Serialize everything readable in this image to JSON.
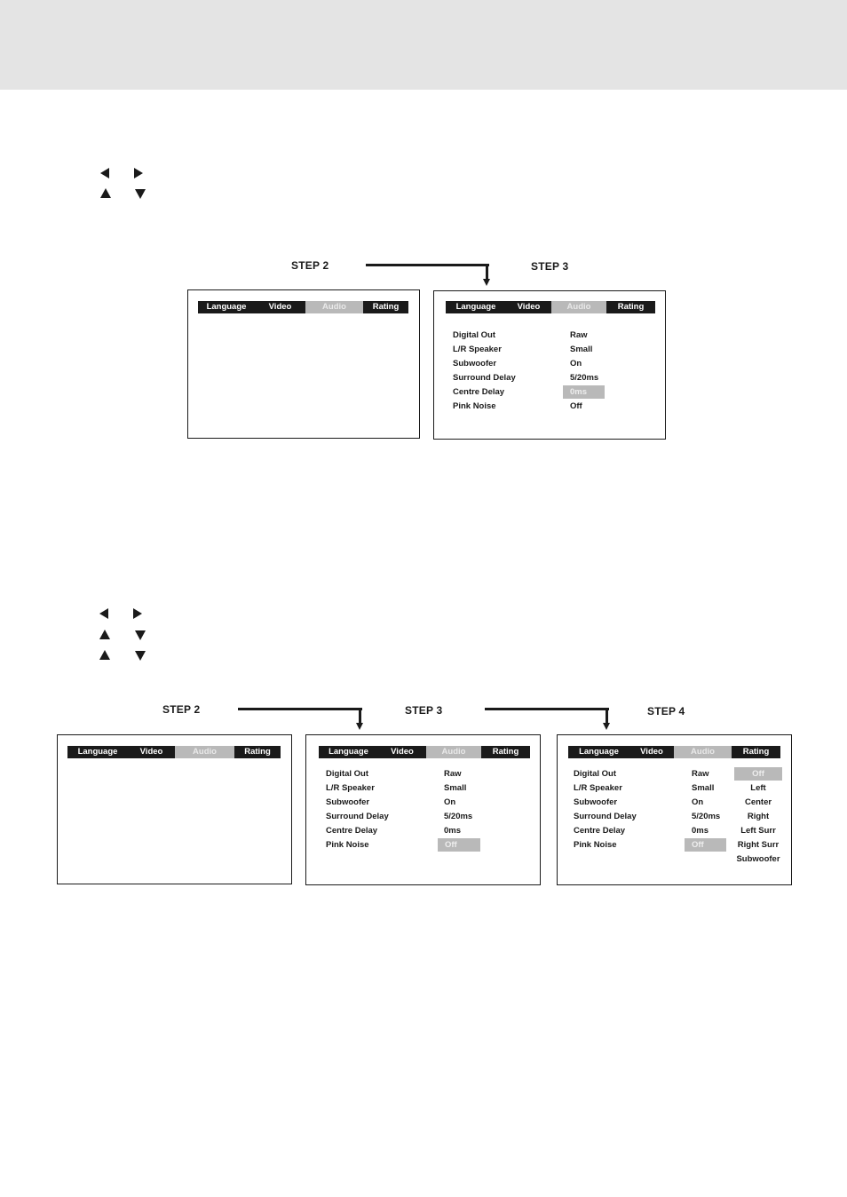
{
  "page": {
    "header_band_color": "#e4e4e4"
  },
  "section1": {
    "nav_icons": [
      "left-arrow",
      "right-arrow",
      "up-arrow",
      "down-arrow"
    ],
    "steps": [
      {
        "label": "STEP 2",
        "menu": [
          "Language",
          "Video",
          "Audio",
          "Rating"
        ],
        "active_tab": "Audio",
        "rows": []
      },
      {
        "label": "STEP 3",
        "menu": [
          "Language",
          "Video",
          "Audio",
          "Rating"
        ],
        "active_tab": "Audio",
        "rows": [
          {
            "label": "Digital Out",
            "value": "Raw"
          },
          {
            "label": "L/R Speaker",
            "value": "Small"
          },
          {
            "label": "Subwoofer",
            "value": "On"
          },
          {
            "label": "Surround Delay",
            "value": "5/20ms"
          },
          {
            "label": "Centre Delay",
            "value": "0ms",
            "highlighted": true
          },
          {
            "label": "Pink Noise",
            "value": "Off"
          }
        ]
      }
    ]
  },
  "section2": {
    "nav_icons": [
      "left-arrow",
      "right-arrow",
      "up-arrow",
      "down-arrow",
      "up-arrow",
      "down-arrow"
    ],
    "steps": [
      {
        "label": "STEP 2",
        "menu": [
          "Language",
          "Video",
          "Audio",
          "Rating"
        ],
        "active_tab": "Audio",
        "rows": []
      },
      {
        "label": "STEP 3",
        "menu": [
          "Language",
          "Video",
          "Audio",
          "Rating"
        ],
        "active_tab": "Audio",
        "rows": [
          {
            "label": "Digital Out",
            "value": "Raw"
          },
          {
            "label": "L/R Speaker",
            "value": "Small"
          },
          {
            "label": "Subwoofer",
            "value": "On"
          },
          {
            "label": "Surround Delay",
            "value": "5/20ms"
          },
          {
            "label": "Centre Delay",
            "value": "0ms"
          },
          {
            "label": "Pink Noise",
            "value": "Off",
            "highlighted": true
          }
        ]
      },
      {
        "label": "STEP 4",
        "menu": [
          "Language",
          "Video",
          "Audio",
          "Rating"
        ],
        "active_tab": "Audio",
        "rows": [
          {
            "label": "Digital Out",
            "value": "Raw"
          },
          {
            "label": "L/R Speaker",
            "value": "Small"
          },
          {
            "label": "Subwoofer",
            "value": "On"
          },
          {
            "label": "Surround Delay",
            "value": "5/20ms"
          },
          {
            "label": "Centre Delay",
            "value": "0ms"
          },
          {
            "label": "Pink Noise",
            "value": "Off",
            "highlighted": true
          }
        ],
        "submenu": [
          "Off",
          "Left",
          "Center",
          "Right",
          "Left Surr",
          "Right Surr",
          "Subwoofer"
        ],
        "submenu_selected": "Off"
      }
    ]
  }
}
